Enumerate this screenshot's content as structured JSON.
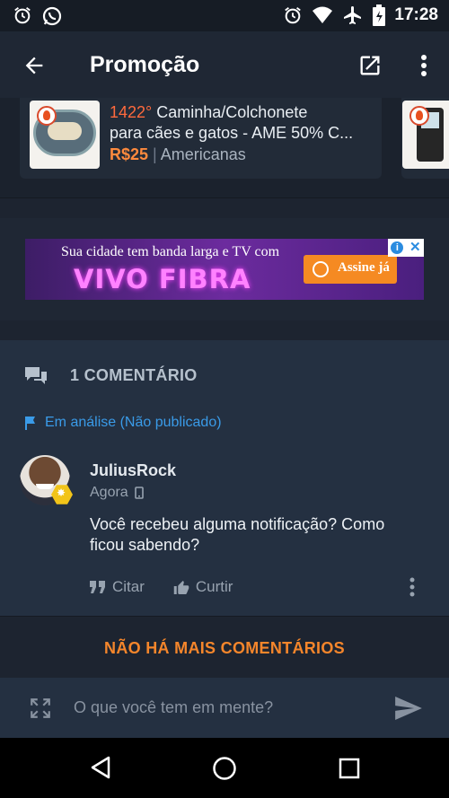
{
  "status_bar": {
    "time": "17:28",
    "left_icons": [
      "alarm-icon",
      "whatsapp-icon"
    ],
    "right_icons": [
      "alarm-icon",
      "wifi-icon",
      "airplane-mode-icon",
      "battery-icon"
    ]
  },
  "app_bar": {
    "title": "Promoção",
    "back_icon": "arrow-left-icon",
    "share_icon": "open-external-icon",
    "menu_icon": "more-vert-icon"
  },
  "related_deal": {
    "temperature": "1422°",
    "title_line1": "Caminha/Colchonete",
    "title_line2": "para cães e gatos - AME 50% C...",
    "price": "R$25",
    "separator": "|",
    "store": "Americanas"
  },
  "ad": {
    "headline": "Sua cidade tem banda larga e TV com",
    "brand": "VIVO FIBRA",
    "cta": "Assine já",
    "info_symbol": "i",
    "close_symbol": "✕"
  },
  "comments_section": {
    "count_label": "1 COMENTÁRIO",
    "review_status": "Em análise (Não publicado)",
    "comment": {
      "author": "JuliusRock",
      "time": "Agora",
      "text": "Você recebeu alguma notificação? Como ficou sabendo?",
      "quote_label": "Citar",
      "like_label": "Curtir"
    }
  },
  "end_message": "NÃO HÁ MAIS COMENTÁRIOS",
  "composer": {
    "placeholder": "O que você tem em mente?"
  },
  "colors": {
    "background": "#1d2430",
    "accent_orange": "#f5862b",
    "link_blue": "#3a9be8",
    "temperature_red": "#ff6a3d"
  }
}
